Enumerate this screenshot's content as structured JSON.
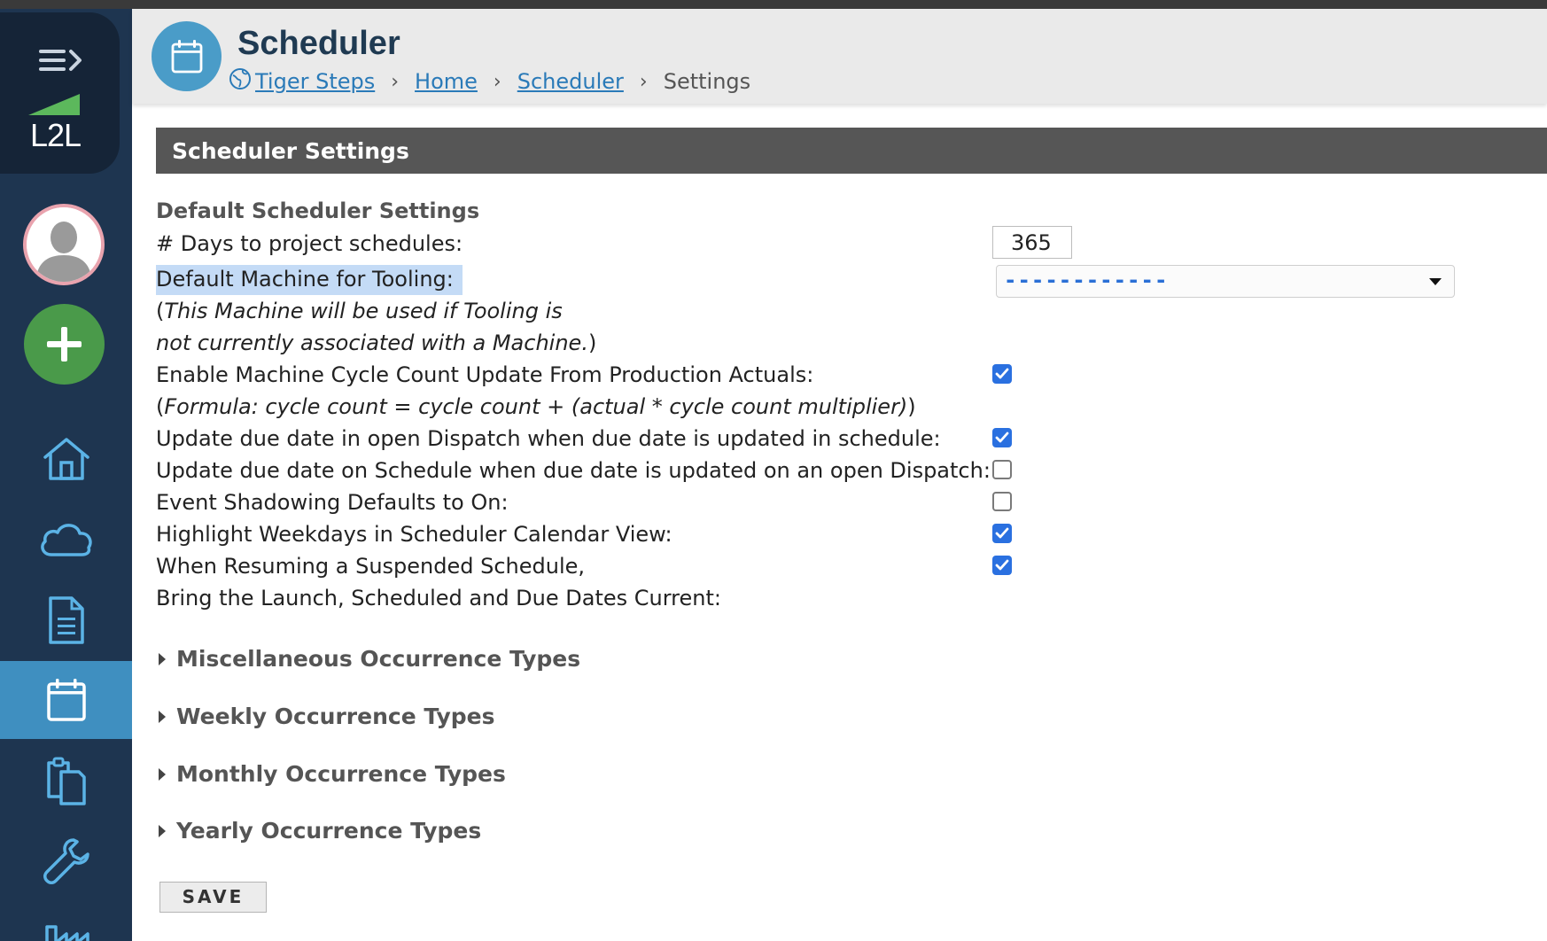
{
  "app": {
    "logo_text": "L2L"
  },
  "header": {
    "title": "Scheduler",
    "icon": "calendar-icon",
    "breadcrumb": {
      "site_icon": "globe-icon",
      "items": [
        "Tiger Steps",
        "Home",
        "Scheduler"
      ],
      "current": "Settings",
      "separator": "›"
    }
  },
  "sidebar": {
    "items": [
      {
        "icon": "home-icon",
        "active": false
      },
      {
        "icon": "cloud-icon",
        "active": false
      },
      {
        "icon": "document-icon",
        "active": false
      },
      {
        "icon": "calendar-icon",
        "active": true
      },
      {
        "icon": "clipboard-icon",
        "active": false
      },
      {
        "icon": "wrench-icon",
        "active": false
      },
      {
        "icon": "factory-icon",
        "active": false
      }
    ]
  },
  "main": {
    "section_title": "Scheduler Settings",
    "subheading": "Default Scheduler Settings",
    "days_label": "# Days to project schedules:",
    "days_value": "365",
    "machine_label": "Default Machine for Tooling:",
    "machine_note_1": "This Machine will be used if Tooling is",
    "machine_note_2": "not currently associated with a Machine.",
    "machine_value": "------------",
    "cycle_label": "Enable Machine Cycle Count Update From Production Actuals:",
    "cycle_formula": "Formula: cycle count = cycle count + (actual * cycle count multiplier)",
    "cycle_checked": true,
    "dispatch_label": "Update due date in open Dispatch when due date is updated in schedule:",
    "dispatch_checked": true,
    "schedule_label": "Update due date on Schedule when due date is updated on an open Dispatch:",
    "schedule_checked": false,
    "shadow_label": "Event Shadowing Defaults to On:",
    "shadow_checked": false,
    "weekdays_label": "Highlight Weekdays in Scheduler Calendar View:",
    "weekdays_checked": true,
    "resume_label_1": "When Resuming a Suspended Schedule,",
    "resume_label_2": "Bring the Launch, Scheduled and Due Dates Current:",
    "resume_checked": true,
    "sections": [
      "Miscellaneous Occurrence Types",
      "Weekly Occurrence Types",
      "Monthly Occurrence Types",
      "Yearly Occurrence Types"
    ],
    "save_label": "SAVE"
  },
  "colors": {
    "sidebar": "#1e3550",
    "active_nav": "#3f8fc0",
    "accent": "#4a9cc8",
    "link": "#2a7ab8",
    "add_button": "#4a9a4a",
    "checkbox": "#2a70e0"
  }
}
